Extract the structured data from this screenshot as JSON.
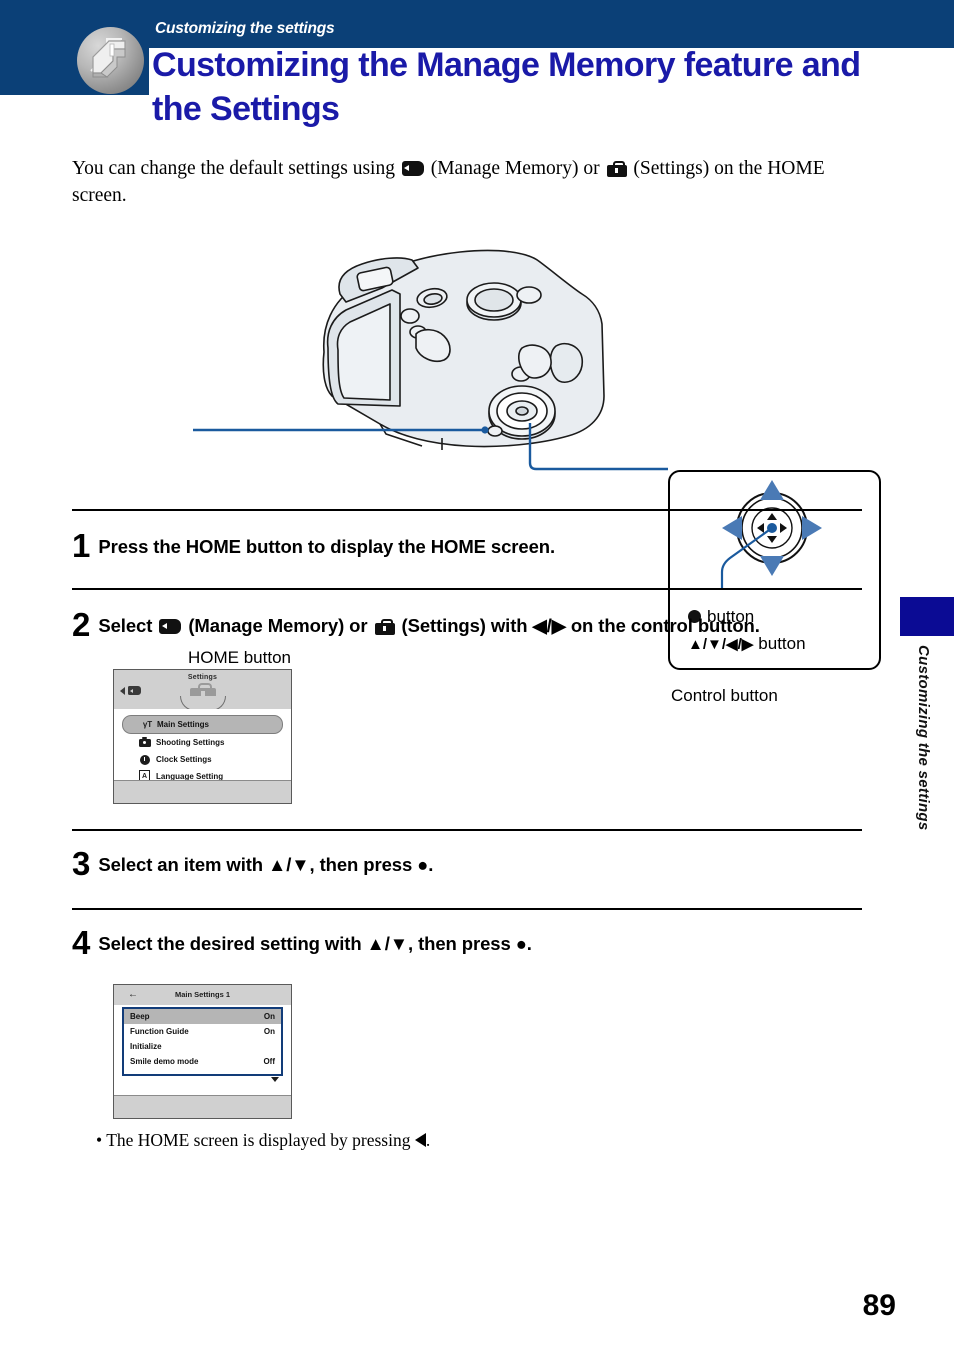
{
  "header": {
    "eyebrow": "Customizing the settings",
    "title": "Customizing the Manage Memory feature and the Settings",
    "emblem_icon": "book-corner-emblem",
    "bar_color": "#0b4077",
    "title_color": "#1a1aa8"
  },
  "intro": {
    "part1": "You can change the default settings using ",
    "icon1": "manage-memory-card-icon",
    "part2": " (Manage Memory) or ",
    "icon2": "settings-briefcase-icon",
    "part3": " (Settings) on the HOME screen."
  },
  "figure": {
    "camera_alt": "camera-rear-illustration",
    "home_button_label": "HOME button",
    "control_button_label": "Control button",
    "keybox": {
      "center_button_label": "button",
      "center_button_icon": "filled-circle",
      "direction_button_label": "button",
      "direction_button_icons": "▲/▼/◀/▶",
      "up_icon": "triangle-up-icon",
      "down_icon": "triangle-down-icon",
      "left_icon": "triangle-left-icon",
      "right_icon": "triangle-right-icon"
    },
    "callout_color": "#1a5a9e"
  },
  "steps": [
    {
      "number": "1",
      "text": "Press the HOME button to display the HOME screen."
    },
    {
      "number": "2",
      "text_a": "Select ",
      "icon_a": "manage-memory-card-icon",
      "text_b": " (Manage Memory) or ",
      "icon_b": "settings-briefcase-icon",
      "text_c": " (Settings) with ◀/▶ on the control button."
    },
    {
      "number": "3",
      "text": "Select an item with ▲/▼, then press ●."
    },
    {
      "number": "4",
      "text": "Select the desired setting with ▲/▼, then press ●."
    }
  ],
  "lcd_settings": {
    "title": "Settings",
    "left_nav_icon": "memory-card-icon",
    "left_nav_arrow": "triangle-left-icon",
    "category_icon": "settings-briefcase-icon",
    "items": [
      {
        "label": "Main Settings",
        "icon": "tool-wrench-icon",
        "selected": true
      },
      {
        "label": "Shooting Settings",
        "icon": "camera-icon",
        "selected": false
      },
      {
        "label": "Clock Settings",
        "icon": "clock-icon",
        "selected": false
      },
      {
        "label": "Language Setting",
        "icon": "language-letter-icon",
        "selected": false
      }
    ]
  },
  "lcd_main_settings": {
    "title": "Main Settings 1",
    "back_icon": "arrow-left-icon",
    "scroll_icon": "triangle-down-icon",
    "rows": [
      {
        "label": "Beep",
        "value": "On",
        "selected": true
      },
      {
        "label": "Function Guide",
        "value": "On",
        "selected": false
      },
      {
        "label": "Initialize",
        "value": "",
        "selected": false
      },
      {
        "label": "Smile demo mode",
        "value": "Off",
        "selected": false
      }
    ]
  },
  "note": {
    "bullet": "•",
    "text_a": "The HOME screen is displayed by pressing ",
    "icon": "triangle-left-icon",
    "text_b": "."
  },
  "side_tab": {
    "label": "Customizing the settings",
    "block_color": "#0b0b94"
  },
  "page_number": "89"
}
